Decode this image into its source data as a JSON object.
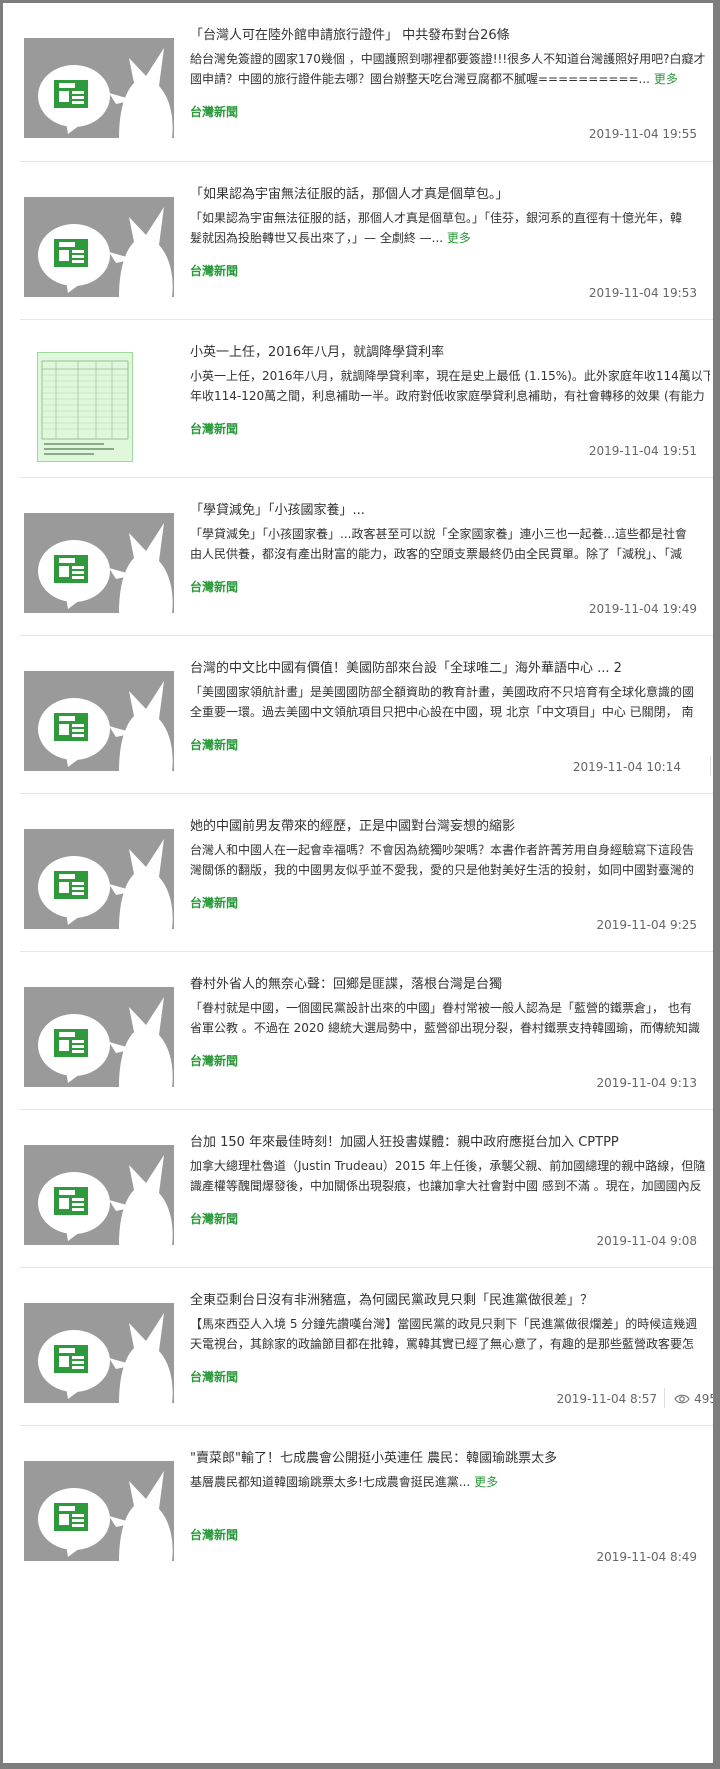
{
  "feed": {
    "items": [
      {
        "title": "「台灣人可在陸外館申請旅行證件」 中共發布對台26條",
        "lines": [
          "給台灣免簽證的國家170幾個 ，中國護照到哪裡都要簽證!!!很多人不知道台灣護照好用吧?白癡才",
          "國申請？中國的旅行證件能去哪？國台辦整天吃台灣豆腐都不膩喔==========..."
        ],
        "more": "更多",
        "source": "台灣新聞",
        "date": "2019-11-04 19:55"
      },
      {
        "title": "「如果認為宇宙無法征服的話，那個人才真是個草包。」",
        "lines": [
          "「如果認為宇宙無法征服的話，那個人才真是個草包。」「佳芬，銀河系的直徑有十億光年，韓",
          "髮就因為投胎轉世又長出來了，」— 全劇終 —..."
        ],
        "more": "更多",
        "source": "台灣新聞",
        "date": "2019-11-04 19:53"
      },
      {
        "title": "小英一上任，2016年八月，就調降學貸利率",
        "lines": [
          "小英一上任，2016年八月，就調降學貸利率，現在是史上最低 (1.15%)。此外家庭年收114萬以下",
          "年收114-120萬之間，利息補助一半。政府對低收家庭學貸利息補助，有社會轉移的效果 (有能力"
        ],
        "more": "",
        "source": "台灣新聞",
        "date": "2019-11-04 19:51"
      },
      {
        "title": "「學貸減免」「小孩國家養」...",
        "lines": [
          "「學貸減免」「小孩國家養」...政客甚至可以說「全家國家養」連小三也一起養...這些都是社會",
          "由人民供養，都沒有產出財富的能力，政客的空頭支票最終仍由全民買單。除了「減稅」、「減"
        ],
        "more": "",
        "source": "台灣新聞",
        "date": "2019-11-04 19:49"
      },
      {
        "title": "台灣的中文比中國有價值！美國防部來台設「全球唯二」海外華語中心 ... 2",
        "lines": [
          "「美國國家領航計畫」是美國國防部全額資助的教育計畫，美國政府不只培育有全球化意識的國",
          "全重要一環。過去美國中文領航項目只把中心設在中國，現 北京「中文項目」中心 已關閉， 南"
        ],
        "more": "",
        "source": "台灣新聞",
        "date": "2019-11-04 10:14"
      },
      {
        "title": "她的中國前男友帶來的經歷，正是中國對台灣妄想的縮影",
        "lines": [
          "台灣人和中國人在一起會幸福嗎？不會因為統獨吵架嗎？本書作者許菁芳用自身經驗寫下這段告",
          "灣關係的翻版，我的中國男友似乎並不愛我，愛的只是他對美好生活的投射，如同中國對臺灣的"
        ],
        "more": "",
        "source": "台灣新聞",
        "date": "2019-11-04 9:25"
      },
      {
        "title": "眷村外省人的無奈心聲：回鄉是匪諜，落根台灣是台獨",
        "lines": [
          "「眷村就是中國，一個國民黨設計出來的中國」眷村常被一般人認為是「藍營的鐵票倉」， 也有",
          "省軍公教 。不過在 2020 總統大選局勢中，藍營卻出現分裂，眷村鐵票支持韓國瑜，而傳統知識"
        ],
        "more": "",
        "source": "台灣新聞",
        "date": "2019-11-04 9:13"
      },
      {
        "title": "台加 150 年來最佳時刻！加國人狂投書媒體：親中政府應挺台加入 CPTPP",
        "lines": [
          "加拿大總理杜魯道（Justin Trudeau）2015 年上任後，承襲父親、前加國總理的親中路線，但隨",
          "識產權等醜聞爆發後，中加關係出現裂痕，也讓加拿大社會對中國 感到不滿 。現在，加國國內反"
        ],
        "more": "",
        "source": "台灣新聞",
        "date": "2019-11-04 9:08"
      },
      {
        "title": "全東亞剩台日沒有非洲豬瘟，為何國民黨政見只剩「民進黨做很差」？",
        "lines": [
          "【馬來西亞人入境 5 分鐘先讚嘆台灣】當國民黨的政見只剩下「民進黨做很爛差」的時候這幾週",
          "天電視台，其餘家的政論節目都在批韓，罵韓其實已經了無心意了，有趣的是那些藍營政客要怎"
        ],
        "more": "",
        "source": "台灣新聞",
        "date": "2019-11-04 8:57",
        "views": "495"
      },
      {
        "title": "\"賣菜郎\"輸了！七成農會公開挺小英連任 農民：韓國瑜跳票太多",
        "lines": [
          "基層農民都知道韓國瑜跳票太多!七成農會挺民進黨..."
        ],
        "more": "更多",
        "source": "台灣新聞",
        "date": "2019-11-04 8:49"
      }
    ]
  },
  "icons": {
    "news_thumbnail": "news-bubble-icon",
    "views": "eye-icon"
  },
  "colors": {
    "accent_green": "#2a9a3a",
    "thumb_gray": "#9a9a9a"
  }
}
